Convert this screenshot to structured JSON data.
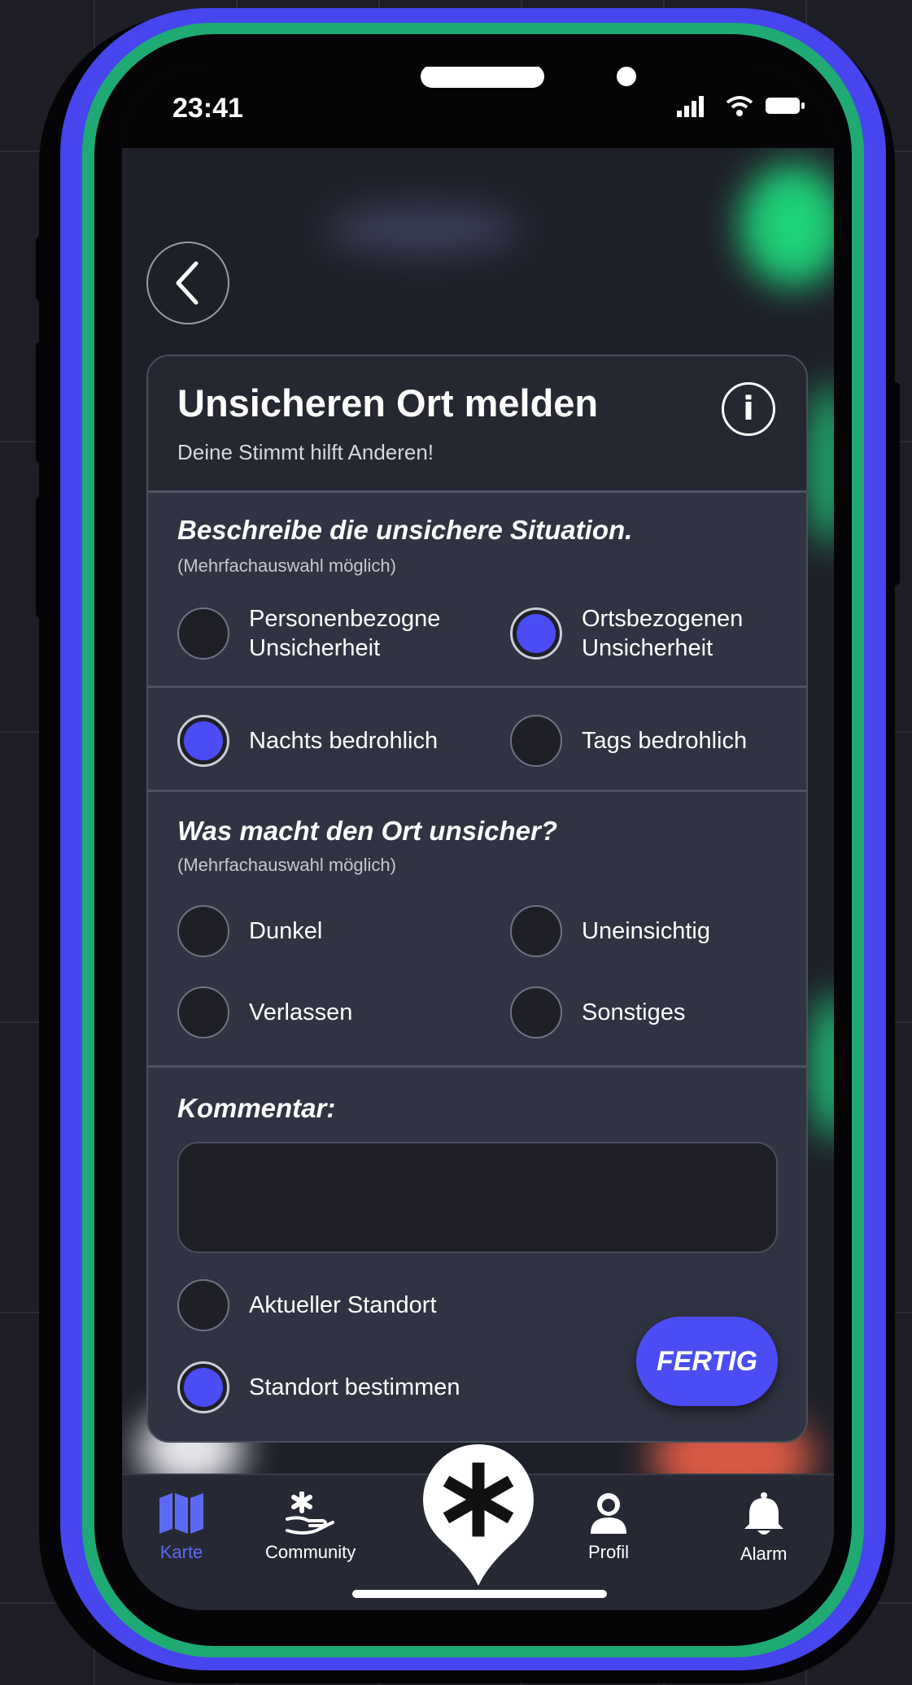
{
  "status_bar": {
    "time": "23:41"
  },
  "form": {
    "title": "Unsicheren Ort melden",
    "subtitle": "Deine Stimmt hilft Anderen!",
    "info_symbol": "i",
    "section1": {
      "title": "Beschreibe die unsichere Situation.",
      "hint": "(Mehrfachauswahl möglich)",
      "options": [
        {
          "label": "Personenbezogne\nUnsicherheit",
          "selected": false
        },
        {
          "label": "Ortsbezogenen\nUnsicherheit",
          "selected": true
        }
      ]
    },
    "time_options": [
      {
        "label": "Nachts bedrohlich",
        "selected": true
      },
      {
        "label": "Tags bedrohlich",
        "selected": false
      }
    ],
    "section2": {
      "title": "Was macht den Ort unsicher?",
      "hint": "(Mehrfachauswahl möglich)",
      "options": [
        {
          "label": "Dunkel",
          "selected": false
        },
        {
          "label": "Uneinsichtig",
          "selected": false
        },
        {
          "label": "Verlassen",
          "selected": false
        },
        {
          "label": "Sonstiges",
          "selected": false
        }
      ]
    },
    "comment": {
      "label": "Kommentar:",
      "value": ""
    },
    "location_options": [
      {
        "label": "Aktueller Standort",
        "selected": false
      },
      {
        "label": "Standort bestimmen",
        "selected": true
      }
    ],
    "submit_label": "FERTIG"
  },
  "tabbar": {
    "items": [
      {
        "label": "Karte",
        "icon": "map-icon",
        "active": true
      },
      {
        "label": "Community",
        "icon": "community-icon",
        "active": false
      },
      {
        "label": "Profil",
        "icon": "profile-icon",
        "active": false
      },
      {
        "label": "Alarm",
        "icon": "bell-icon",
        "active": false
      }
    ],
    "center_icon": "asterisk-pin-icon"
  },
  "colors": {
    "accent": "#4b4cf4",
    "phone_frame": "#4745ee",
    "phone_inner_frame": "#1faa73",
    "card_bg": "#303341",
    "tab_active": "#5b6af5"
  }
}
